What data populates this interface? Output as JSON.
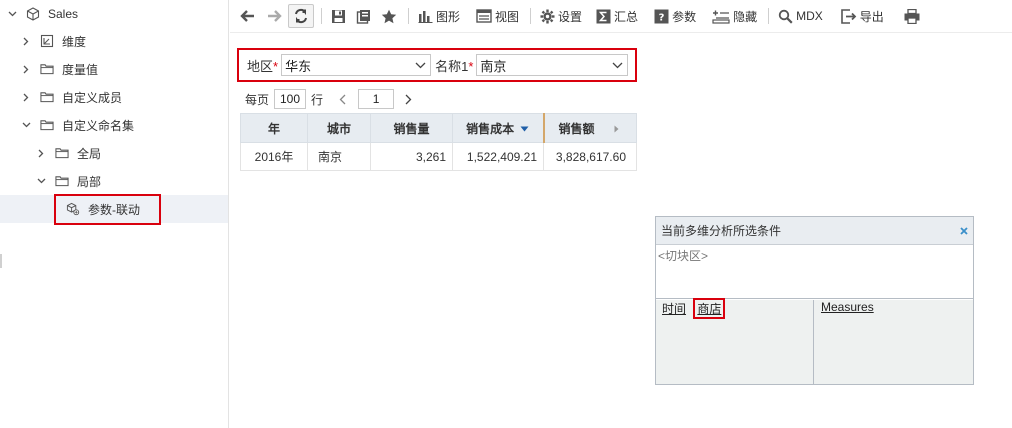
{
  "sidebar": {
    "items": [
      {
        "label": "Sales",
        "icon": "cube-icon",
        "expanded": true
      },
      {
        "label": "维度",
        "icon": "dimension-icon",
        "expanded": false
      },
      {
        "label": "度量值",
        "icon": "folder-icon",
        "expanded": false
      },
      {
        "label": "自定义成员",
        "icon": "folder-icon",
        "expanded": false
      },
      {
        "label": "自定义命名集",
        "icon": "folder-icon",
        "expanded": true
      },
      {
        "label": "全局",
        "icon": "folder-icon",
        "expanded": false
      },
      {
        "label": "局部",
        "icon": "folder-icon",
        "expanded": true
      },
      {
        "label": "参数-联动",
        "icon": "named-set-icon",
        "selected": true
      }
    ]
  },
  "toolbar": {
    "chart": "图形",
    "view": "视图",
    "settings": "设置",
    "summary": "汇总",
    "params": "参数",
    "hide": "隐藏",
    "mdx": "MDX",
    "export": "导出"
  },
  "params": {
    "region_label": "地区",
    "region_value": "华东",
    "name_label": "名称1",
    "name_value": "南京",
    "required_mark": "*"
  },
  "paging": {
    "per_page_label": "每页",
    "per_page_value": "100",
    "rows_label": "行",
    "page_value": "1"
  },
  "table": {
    "headers": [
      "年",
      "城市",
      "销售量",
      "销售成本",
      "销售额"
    ],
    "rows": [
      [
        "2016年",
        "南京",
        "3,261",
        "1,522,409.21",
        "3,828,617.60"
      ]
    ]
  },
  "filter_panel": {
    "title": "当前多维分析所选条件",
    "slicer": "<切块区>",
    "left_items": [
      "时间",
      "商店"
    ],
    "right_items": [
      "Measures"
    ]
  },
  "colors": {
    "highlight_red": "#d9000d",
    "header_bg": "#e7ecf1",
    "accent_blue": "#1f5fa8"
  }
}
